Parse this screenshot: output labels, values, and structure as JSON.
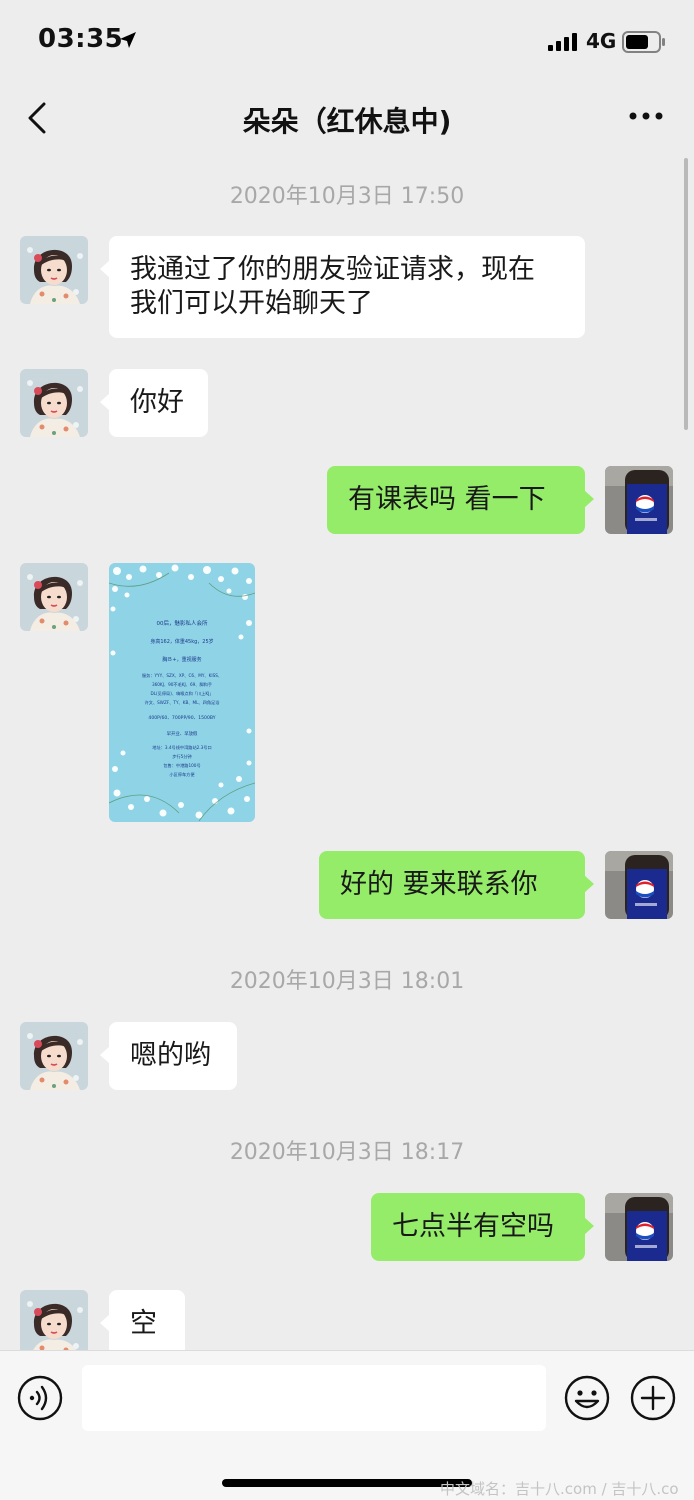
{
  "status_bar": {
    "time": "03:35",
    "network": "4G"
  },
  "nav": {
    "title": "朵朵（红休息中)"
  },
  "messages": {
    "ts1": "2020年10月3日 17:50",
    "m1": "我通过了你的朋友验证请求，现在",
    "m1b": "我们可以开始聊天了",
    "m2": "你好",
    "m3": "有课表吗  看一下",
    "m4": "好的   要来联系你",
    "ts2": "2020年10月3日 18:01",
    "m5": "嗯的哟",
    "ts3": "2020年10月3日 18:17",
    "m6": "七点半有空吗",
    "m7": "空"
  },
  "image_text": {
    "line1": "00后，魅影私人会所",
    "line2": "身高162，体重45kg，25岁",
    "line3": "胸Ｂ+，重视服务",
    "line4": "服务：YYY、SZX、XP、C6、MY、KISS、",
    "line5": "360KJ、90不毛KJ、69、脚和手",
    "line6": "DL(见停局)、嗨喉点和「川上KJ」",
    "line7": "许文、SWZF、TY、KB、ML、四角足浴",
    "line8": "400P/60、700PP/90、1500BY",
    "line9": "早开业、早放假",
    "line10": "地址：3.4号线中湾路站2.3号口",
    "line11": "步行5分钟",
    "line12": "包售：中港路100号",
    "line13": "小区停车方便"
  },
  "watermark": "中文域名：吉十八.com / 吉十八.co",
  "colors": {
    "background": "#ededed",
    "outgoing_bubble": "#95ec69",
    "incoming_bubble": "#ffffff",
    "timestamp": "#a8a8a8"
  },
  "icons": [
    "location-arrow-icon",
    "signal-icon",
    "battery-icon",
    "back-icon",
    "more-icon",
    "voice-icon",
    "emoji-icon",
    "plus-icon"
  ]
}
